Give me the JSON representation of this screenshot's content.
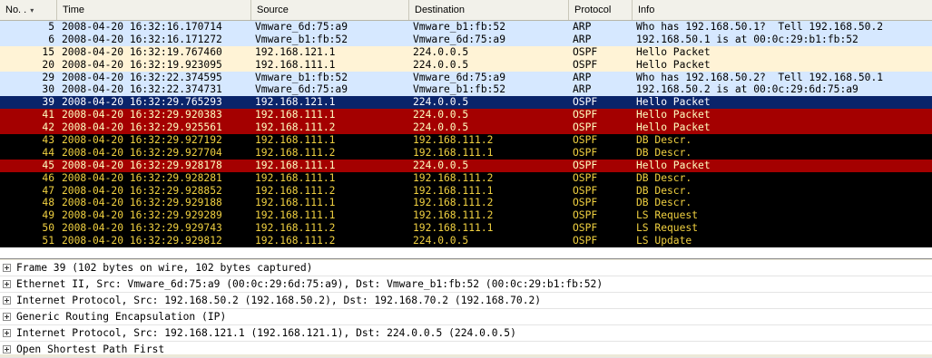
{
  "columns": {
    "no": "No. .",
    "time": "Time",
    "source": "Source",
    "destination": "Destination",
    "protocol": "Protocol",
    "info": "Info"
  },
  "packets": [
    {
      "no": "5",
      "time": "2008-04-20 16:32:16.170714",
      "source": "Vmware_6d:75:a9",
      "destination": "Vmware_b1:fb:52",
      "protocol": "ARP",
      "info": "Who has 192.168.50.1?  Tell 192.168.50.2",
      "bg": "#d6e8ff",
      "fg": "#000000"
    },
    {
      "no": "6",
      "time": "2008-04-20 16:32:16.171272",
      "source": "Vmware_b1:fb:52",
      "destination": "Vmware_6d:75:a9",
      "protocol": "ARP",
      "info": "192.168.50.1 is at 00:0c:29:b1:fb:52",
      "bg": "#d6e8ff",
      "fg": "#000000"
    },
    {
      "no": "15",
      "time": "2008-04-20 16:32:19.767460",
      "source": "192.168.121.1",
      "destination": "224.0.0.5",
      "protocol": "OSPF",
      "info": "Hello Packet",
      "bg": "#fff3d6",
      "fg": "#000000"
    },
    {
      "no": "20",
      "time": "2008-04-20 16:32:19.923095",
      "source": "192.168.111.1",
      "destination": "224.0.0.5",
      "protocol": "OSPF",
      "info": "Hello Packet",
      "bg": "#fff3d6",
      "fg": "#000000"
    },
    {
      "no": "29",
      "time": "2008-04-20 16:32:22.374595",
      "source": "Vmware_b1:fb:52",
      "destination": "Vmware_6d:75:a9",
      "protocol": "ARP",
      "info": "Who has 192.168.50.2?  Tell 192.168.50.1",
      "bg": "#d6e8ff",
      "fg": "#000000"
    },
    {
      "no": "30",
      "time": "2008-04-20 16:32:22.374731",
      "source": "Vmware_6d:75:a9",
      "destination": "Vmware_b1:fb:52",
      "protocol": "ARP",
      "info": "192.168.50.2 is at 00:0c:29:6d:75:a9",
      "bg": "#d6e8ff",
      "fg": "#000000"
    },
    {
      "no": "39",
      "time": "2008-04-20 16:32:29.765293",
      "source": "192.168.121.1",
      "destination": "224.0.0.5",
      "protocol": "OSPF",
      "info": "Hello Packet",
      "bg": "#0a246a",
      "fg": "#ffffff"
    },
    {
      "no": "41",
      "time": "2008-04-20 16:32:29.920383",
      "source": "192.168.111.1",
      "destination": "224.0.0.5",
      "protocol": "OSPF",
      "info": "Hello Packet",
      "bg": "#a40000",
      "fg": "#ffffc0"
    },
    {
      "no": "42",
      "time": "2008-04-20 16:32:29.925561",
      "source": "192.168.111.2",
      "destination": "224.0.0.5",
      "protocol": "OSPF",
      "info": "Hello Packet",
      "bg": "#a40000",
      "fg": "#ffffc0"
    },
    {
      "no": "43",
      "time": "2008-04-20 16:32:29.927192",
      "source": "192.168.111.1",
      "destination": "192.168.111.2",
      "protocol": "OSPF",
      "info": "DB Descr.",
      "bg": "#000000",
      "fg": "#f0d040"
    },
    {
      "no": "44",
      "time": "2008-04-20 16:32:29.927704",
      "source": "192.168.111.2",
      "destination": "192.168.111.1",
      "protocol": "OSPF",
      "info": "DB Descr.",
      "bg": "#000000",
      "fg": "#f0d040"
    },
    {
      "no": "45",
      "time": "2008-04-20 16:32:29.928178",
      "source": "192.168.111.1",
      "destination": "224.0.0.5",
      "protocol": "OSPF",
      "info": "Hello Packet",
      "bg": "#a40000",
      "fg": "#ffffc0"
    },
    {
      "no": "46",
      "time": "2008-04-20 16:32:29.928281",
      "source": "192.168.111.1",
      "destination": "192.168.111.2",
      "protocol": "OSPF",
      "info": "DB Descr.",
      "bg": "#000000",
      "fg": "#f0d040"
    },
    {
      "no": "47",
      "time": "2008-04-20 16:32:29.928852",
      "source": "192.168.111.2",
      "destination": "192.168.111.1",
      "protocol": "OSPF",
      "info": "DB Descr.",
      "bg": "#000000",
      "fg": "#f0d040"
    },
    {
      "no": "48",
      "time": "2008-04-20 16:32:29.929188",
      "source": "192.168.111.1",
      "destination": "192.168.111.2",
      "protocol": "OSPF",
      "info": "DB Descr.",
      "bg": "#000000",
      "fg": "#f0d040"
    },
    {
      "no": "49",
      "time": "2008-04-20 16:32:29.929289",
      "source": "192.168.111.1",
      "destination": "192.168.111.2",
      "protocol": "OSPF",
      "info": "LS Request",
      "bg": "#000000",
      "fg": "#f0d040"
    },
    {
      "no": "50",
      "time": "2008-04-20 16:32:29.929743",
      "source": "192.168.111.2",
      "destination": "192.168.111.1",
      "protocol": "OSPF",
      "info": "LS Request",
      "bg": "#000000",
      "fg": "#f0d040"
    },
    {
      "no": "51",
      "time": "2008-04-20 16:32:29.929812",
      "source": "192.168.111.2",
      "destination": "224.0.0.5",
      "protocol": "OSPF",
      "info": "LS Update",
      "bg": "#000000",
      "fg": "#f0d040"
    }
  ],
  "details": [
    "Frame 39 (102 bytes on wire, 102 bytes captured)",
    "Ethernet II, Src: Vmware_6d:75:a9 (00:0c:29:6d:75:a9), Dst: Vmware_b1:fb:52 (00:0c:29:b1:fb:52)",
    "Internet Protocol, Src: 192.168.50.2 (192.168.50.2), Dst: 192.168.70.2 (192.168.70.2)",
    "Generic Routing Encapsulation (IP)",
    "Internet Protocol, Src: 192.168.121.1 (192.168.121.1), Dst: 224.0.0.5 (224.0.0.5)",
    "Open Shortest Path First"
  ]
}
